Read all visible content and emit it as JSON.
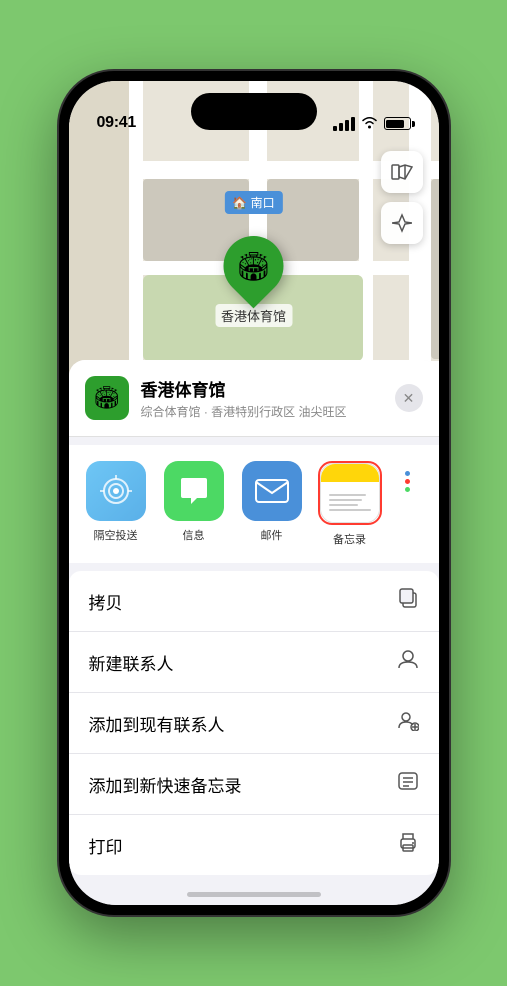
{
  "status": {
    "time": "09:41",
    "location_arrow": "▶"
  },
  "map": {
    "location_label": "南口",
    "pin_label": "香港体育馆",
    "controls": {
      "map_icon": "🗺",
      "location_icon": "↗"
    }
  },
  "bottom_sheet": {
    "venue_name": "香港体育馆",
    "venue_sub": "综合体育馆 · 香港特别行政区 油尖旺区",
    "close_label": "✕",
    "share_items": [
      {
        "id": "airdrop",
        "label": "隔空投送",
        "selected": false
      },
      {
        "id": "messages",
        "label": "信息",
        "selected": false
      },
      {
        "id": "mail",
        "label": "邮件",
        "selected": false
      },
      {
        "id": "notes",
        "label": "备忘录",
        "selected": true
      }
    ],
    "actions": [
      {
        "label": "拷贝",
        "icon": "⧉"
      },
      {
        "label": "新建联系人",
        "icon": "👤"
      },
      {
        "label": "添加到现有联系人",
        "icon": "👥"
      },
      {
        "label": "添加到新快速备忘录",
        "icon": "📋"
      },
      {
        "label": "打印",
        "icon": "🖨"
      }
    ]
  }
}
